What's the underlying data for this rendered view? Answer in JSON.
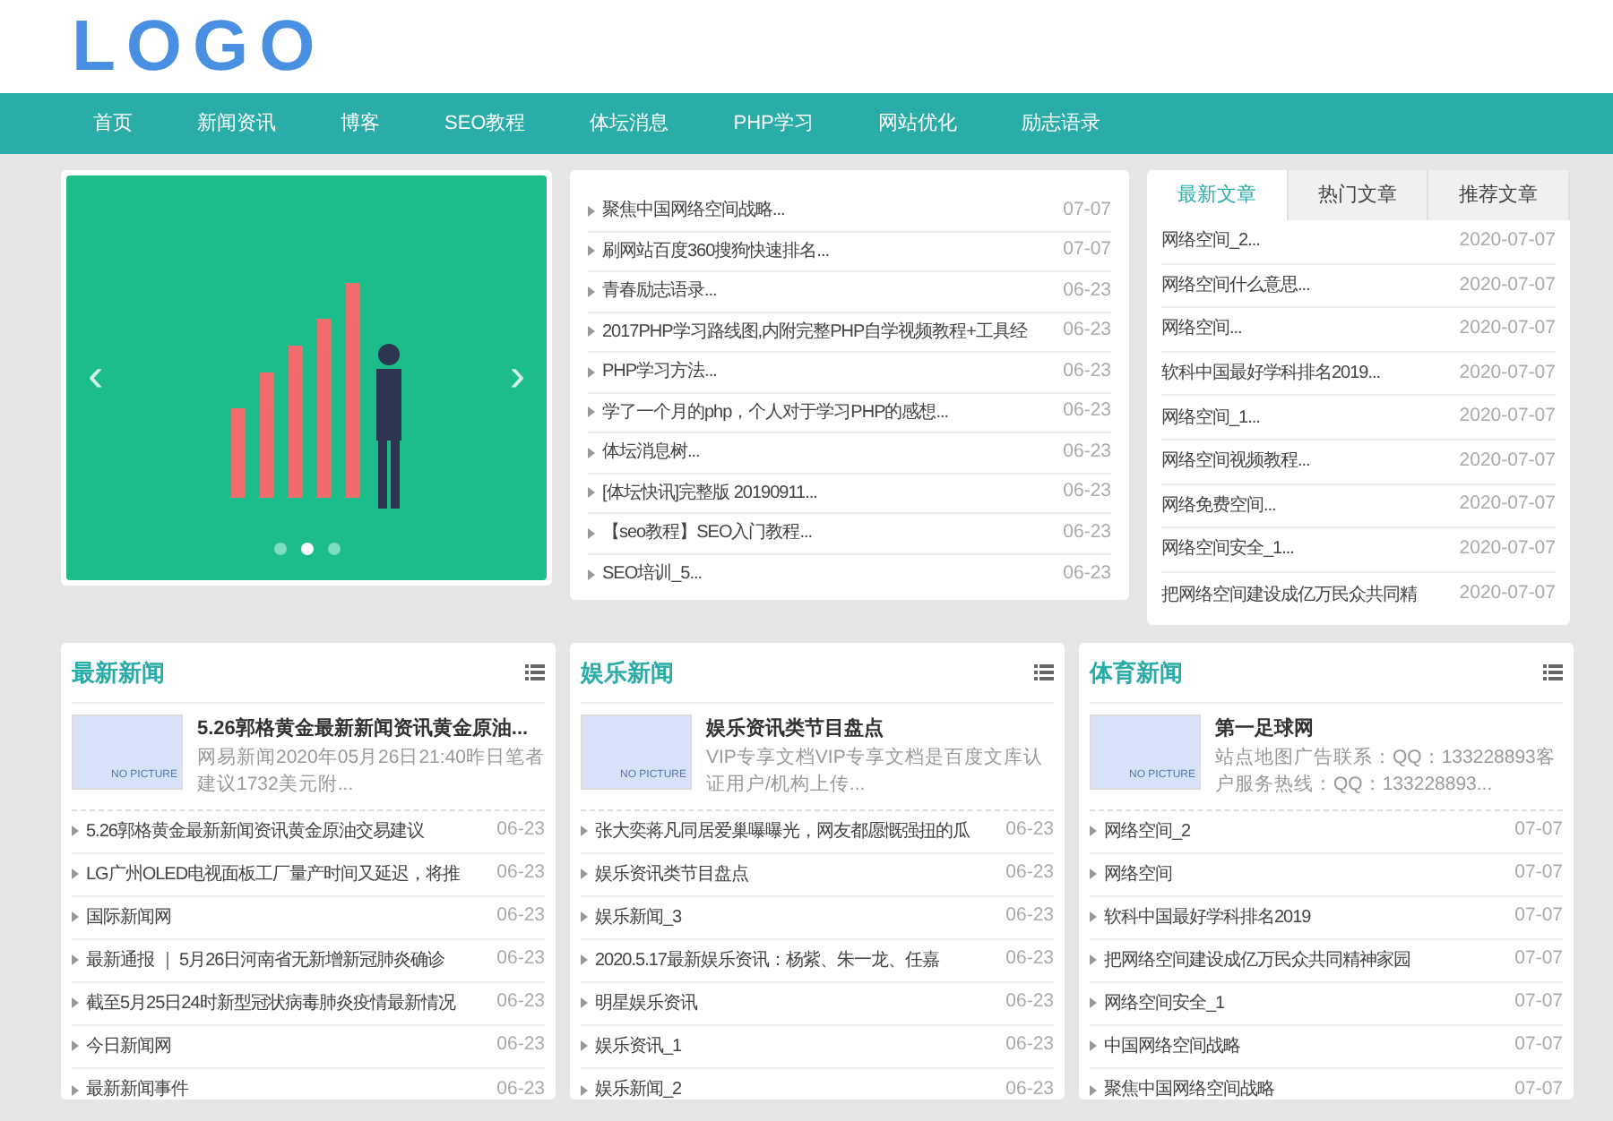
{
  "logo": "LOGO",
  "nav": [
    {
      "label": "首页",
      "selected": false
    },
    {
      "label": "新闻资讯",
      "selected": false
    },
    {
      "label": "博客",
      "selected": false
    },
    {
      "label": "SEO教程",
      "selected": false
    },
    {
      "label": "体坛消息",
      "selected": false
    },
    {
      "label": "PHP学习",
      "selected": false
    },
    {
      "label": "网站优化",
      "selected": false
    },
    {
      "label": "励志语录",
      "selected": false
    }
  ],
  "slider": {
    "prev": "‹",
    "next": "›",
    "dots": [
      {
        "selected": false
      },
      {
        "selected": true
      },
      {
        "selected": false
      }
    ]
  },
  "list": [
    {
      "title": "聚焦中国网络空间战略...",
      "date": "07-07"
    },
    {
      "title": "刷网站百度360搜狗快速排名...",
      "date": "07-07"
    },
    {
      "title": "青春励志语录...",
      "date": "06-23"
    },
    {
      "title": "2017PHP学习路线图,内附完整PHP自学视频教程+工具经",
      "date": "06-23"
    },
    {
      "title": "PHP学习方法...",
      "date": "06-23"
    },
    {
      "title": "学了一个月的php，个人对于学习PHP的感想...",
      "date": "06-23"
    },
    {
      "title": "体坛消息树...",
      "date": "06-23"
    },
    {
      "title": "[体坛快讯]完整版 20190911...",
      "date": "06-23"
    },
    {
      "title": "【seo教程】SEO入门教程...",
      "date": "06-23"
    },
    {
      "title": "SEO培训_5...",
      "date": "06-23"
    }
  ],
  "tabs": [
    {
      "label": "最新文章",
      "selected": true
    },
    {
      "label": "热门文章",
      "selected": false
    },
    {
      "label": "推荐文章",
      "selected": false
    }
  ],
  "tab_list": [
    {
      "title": "网络空间_2...",
      "date": "2020-07-07"
    },
    {
      "title": "网络空间什么意思...",
      "date": "2020-07-07"
    },
    {
      "title": "网络空间...",
      "date": "2020-07-07"
    },
    {
      "title": "软科中国最好学科排名2019...",
      "date": "2020-07-07"
    },
    {
      "title": "网络空间_1...",
      "date": "2020-07-07"
    },
    {
      "title": "网络空间视频教程...",
      "date": "2020-07-07"
    },
    {
      "title": "网络免费空间...",
      "date": "2020-07-07"
    },
    {
      "title": "网络空间安全_1...",
      "date": "2020-07-07"
    },
    {
      "title": "把网络空间建设成亿万民众共同精",
      "date": "2020-07-07"
    }
  ],
  "panels": [
    {
      "title": "最新新闻",
      "featured": {
        "image_text": "NO PICTURE",
        "title": "5.26郭格黄金最新新闻资讯黄金原油...",
        "summary": "网易新闻2020年05月26日21:40昨日笔者建议1732美元附..."
      },
      "items": [
        {
          "title": "5.26郭格黄金最新新闻资讯黄金原油交易建议",
          "date": "06-23"
        },
        {
          "title": "LG广州OLED电视面板工厂量产时间又延迟，将推",
          "date": "06-23"
        },
        {
          "title": "国际新闻网",
          "date": "06-23"
        },
        {
          "title": "最新通报 ｜ 5月26日河南省无新增新冠肺炎确诊",
          "date": "06-23"
        },
        {
          "title": "截至5月25日24时新型冠状病毒肺炎疫情最新情况",
          "date": "06-23"
        },
        {
          "title": "今日新闻网",
          "date": "06-23"
        },
        {
          "title": "最新新闻事件",
          "date": "06-23"
        }
      ]
    },
    {
      "title": "娱乐新闻",
      "featured": {
        "image_text": "NO PICTURE",
        "title": "娱乐资讯类节目盘点",
        "summary": "VIP专享文档VIP专享文档是百度文库认证用户/机构上传..."
      },
      "items": [
        {
          "title": "张大奕蒋凡同居爱巢曝曝光，网友都愿慨强扭的瓜",
          "date": "06-23"
        },
        {
          "title": "娱乐资讯类节目盘点",
          "date": "06-23"
        },
        {
          "title": "娱乐新闻_3",
          "date": "06-23"
        },
        {
          "title": "2020.5.17最新娱乐资讯：杨紫、朱一龙、任嘉",
          "date": "06-23"
        },
        {
          "title": "明星娱乐资讯",
          "date": "06-23"
        },
        {
          "title": "娱乐资讯_1",
          "date": "06-23"
        },
        {
          "title": "娱乐新闻_2",
          "date": "06-23"
        }
      ]
    },
    {
      "title": "体育新闻",
      "featured": {
        "image_text": "NO PICTURE",
        "title": "第一足球网",
        "summary": "站点地图广告联系：QQ：133228893客户服务热线：QQ：133228893..."
      },
      "items": [
        {
          "title": "网络空间_2",
          "date": "07-07"
        },
        {
          "title": "网络空间",
          "date": "07-07"
        },
        {
          "title": "软科中国最好学科排名2019",
          "date": "07-07"
        },
        {
          "title": "把网络空间建设成亿万民众共同精神家园",
          "date": "07-07"
        },
        {
          "title": "网络空间安全_1",
          "date": "07-07"
        },
        {
          "title": "中国网络空间战略",
          "date": "07-07"
        },
        {
          "title": "聚焦中国网络空间战略",
          "date": "07-07"
        }
      ]
    }
  ]
}
